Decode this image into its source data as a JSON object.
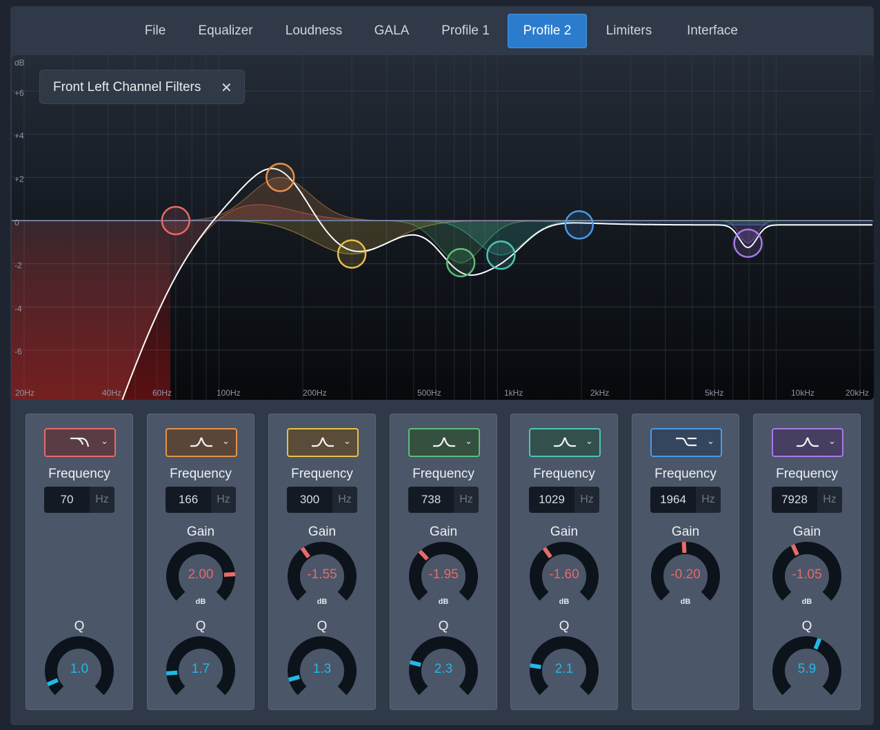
{
  "tabs": [
    {
      "label": "File",
      "active": false
    },
    {
      "label": "Equalizer",
      "active": false
    },
    {
      "label": "Loudness",
      "active": false
    },
    {
      "label": "GALA",
      "active": false
    },
    {
      "label": "Profile 1",
      "active": false
    },
    {
      "label": "Profile 2",
      "active": true
    },
    {
      "label": "Limiters",
      "active": false
    },
    {
      "label": "Interface",
      "active": false
    }
  ],
  "graph": {
    "chip_title": "Front Left Channel Filters",
    "y_axis": {
      "unit": "dB",
      "ticks": [
        "+6",
        "+4",
        "+2",
        "0",
        "-2",
        "-4",
        "-6"
      ],
      "range": [
        -8,
        7.5
      ]
    },
    "x_axis": {
      "ticks": [
        {
          "label": "20Hz",
          "hz": 20
        },
        {
          "label": "40Hz",
          "hz": 40
        },
        {
          "label": "60Hz",
          "hz": 60
        },
        {
          "label": "100Hz",
          "hz": 100
        },
        {
          "label": "200Hz",
          "hz": 200
        },
        {
          "label": "500Hz",
          "hz": 500
        },
        {
          "label": "1kHz",
          "hz": 1000
        },
        {
          "label": "2kHz",
          "hz": 2000
        },
        {
          "label": "5kHz",
          "hz": 5000
        },
        {
          "label": "10kHz",
          "hz": 10000
        },
        {
          "label": "20kHz",
          "hz": 20000
        }
      ]
    }
  },
  "filters": [
    {
      "type": "high-pass",
      "type_icon": "highpass-icon",
      "color": "#e86a6a",
      "bg": "#5a3c44",
      "frequency": "70",
      "hz_unit": "Hz",
      "has_gain": false,
      "q": "1.0",
      "q_norm": 0.08,
      "freq_label": "Frequency",
      "gain_label": "Gain",
      "q_label": "Q"
    },
    {
      "type": "peak",
      "type_icon": "peak-filter-icon",
      "color": "#e8924a",
      "bg": "#5a4638",
      "frequency": "166",
      "hz_unit": "Hz",
      "has_gain": true,
      "gain": "2.00",
      "gain_norm": 0.82,
      "gain_unit": "dB",
      "q": "1.7",
      "q_norm": 0.15,
      "freq_label": "Frequency",
      "gain_label": "Gain",
      "q_label": "Q"
    },
    {
      "type": "peak",
      "type_icon": "peak-filter-icon",
      "color": "#e8c24a",
      "bg": "#5a4c38",
      "frequency": "300",
      "hz_unit": "Hz",
      "has_gain": true,
      "gain": "-1.55",
      "gain_norm": 0.37,
      "gain_unit": "dB",
      "q": "1.3",
      "q_norm": 0.11,
      "freq_label": "Frequency",
      "gain_label": "Gain",
      "q_label": "Q"
    },
    {
      "type": "peak",
      "type_icon": "peak-filter-icon",
      "color": "#5cbf7a",
      "bg": "#35503f",
      "frequency": "738",
      "hz_unit": "Hz",
      "has_gain": true,
      "gain": "-1.95",
      "gain_norm": 0.34,
      "gain_unit": "dB",
      "q": "2.3",
      "q_norm": 0.22,
      "freq_label": "Frequency",
      "gain_label": "Gain",
      "q_label": "Q"
    },
    {
      "type": "peak",
      "type_icon": "peak-filter-icon",
      "color": "#4ac7b4",
      "bg": "#33504d",
      "frequency": "1029",
      "hz_unit": "Hz",
      "has_gain": true,
      "gain": "-1.60",
      "gain_norm": 0.37,
      "gain_unit": "dB",
      "q": "2.1",
      "q_norm": 0.2,
      "freq_label": "Frequency",
      "gain_label": "Gain",
      "q_label": "Q"
    },
    {
      "type": "high-shelf",
      "type_icon": "shelf-filter-icon",
      "color": "#4a9ae8",
      "bg": "#34465e",
      "frequency": "1964",
      "hz_unit": "Hz",
      "has_gain": true,
      "gain": "-0.20",
      "gain_norm": 0.49,
      "gain_unit": "dB",
      "q": "",
      "has_q": false,
      "freq_label": "Frequency",
      "gain_label": "Gain",
      "q_label": "Q"
    },
    {
      "type": "peak",
      "type_icon": "peak-filter-icon",
      "color": "#a77be8",
      "bg": "#483e62",
      "frequency": "7928",
      "hz_unit": "Hz",
      "has_gain": true,
      "gain": "-1.05",
      "gain_norm": 0.41,
      "gain_unit": "dB",
      "q": "5.9",
      "q_norm": 0.58,
      "freq_label": "Frequency",
      "gain_label": "Gain",
      "q_label": "Q"
    }
  ],
  "colors": {
    "gain_indicator": "#e86a6a",
    "q_indicator": "#22b8e8",
    "knob_track": "#0d131b",
    "gain_text": "#e86a6a",
    "q_text": "#22b8e8"
  }
}
